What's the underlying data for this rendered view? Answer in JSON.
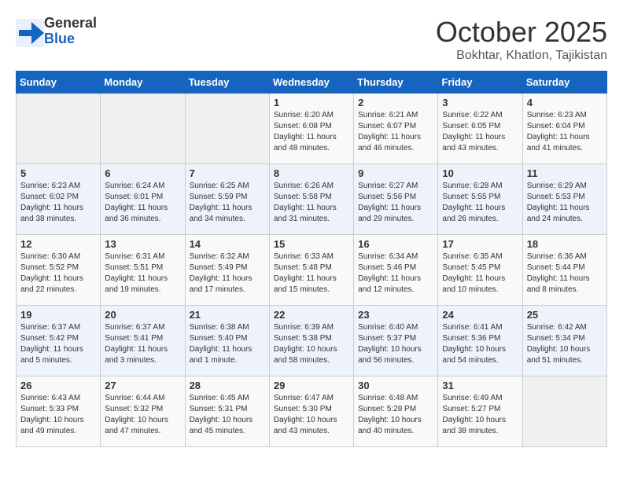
{
  "header": {
    "logo_line1": "General",
    "logo_line2": "Blue",
    "month": "October 2025",
    "location": "Bokhtar, Khatlon, Tajikistan"
  },
  "weekdays": [
    "Sunday",
    "Monday",
    "Tuesday",
    "Wednesday",
    "Thursday",
    "Friday",
    "Saturday"
  ],
  "weeks": [
    [
      {
        "day": "",
        "info": ""
      },
      {
        "day": "",
        "info": ""
      },
      {
        "day": "",
        "info": ""
      },
      {
        "day": "1",
        "info": "Sunrise: 6:20 AM\nSunset: 6:08 PM\nDaylight: 11 hours\nand 48 minutes."
      },
      {
        "day": "2",
        "info": "Sunrise: 6:21 AM\nSunset: 6:07 PM\nDaylight: 11 hours\nand 46 minutes."
      },
      {
        "day": "3",
        "info": "Sunrise: 6:22 AM\nSunset: 6:05 PM\nDaylight: 11 hours\nand 43 minutes."
      },
      {
        "day": "4",
        "info": "Sunrise: 6:23 AM\nSunset: 6:04 PM\nDaylight: 11 hours\nand 41 minutes."
      }
    ],
    [
      {
        "day": "5",
        "info": "Sunrise: 6:23 AM\nSunset: 6:02 PM\nDaylight: 11 hours\nand 38 minutes."
      },
      {
        "day": "6",
        "info": "Sunrise: 6:24 AM\nSunset: 6:01 PM\nDaylight: 11 hours\nand 36 minutes."
      },
      {
        "day": "7",
        "info": "Sunrise: 6:25 AM\nSunset: 5:59 PM\nDaylight: 11 hours\nand 34 minutes."
      },
      {
        "day": "8",
        "info": "Sunrise: 6:26 AM\nSunset: 5:58 PM\nDaylight: 11 hours\nand 31 minutes."
      },
      {
        "day": "9",
        "info": "Sunrise: 6:27 AM\nSunset: 5:56 PM\nDaylight: 11 hours\nand 29 minutes."
      },
      {
        "day": "10",
        "info": "Sunrise: 6:28 AM\nSunset: 5:55 PM\nDaylight: 11 hours\nand 26 minutes."
      },
      {
        "day": "11",
        "info": "Sunrise: 6:29 AM\nSunset: 5:53 PM\nDaylight: 11 hours\nand 24 minutes."
      }
    ],
    [
      {
        "day": "12",
        "info": "Sunrise: 6:30 AM\nSunset: 5:52 PM\nDaylight: 11 hours\nand 22 minutes."
      },
      {
        "day": "13",
        "info": "Sunrise: 6:31 AM\nSunset: 5:51 PM\nDaylight: 11 hours\nand 19 minutes."
      },
      {
        "day": "14",
        "info": "Sunrise: 6:32 AM\nSunset: 5:49 PM\nDaylight: 11 hours\nand 17 minutes."
      },
      {
        "day": "15",
        "info": "Sunrise: 6:33 AM\nSunset: 5:48 PM\nDaylight: 11 hours\nand 15 minutes."
      },
      {
        "day": "16",
        "info": "Sunrise: 6:34 AM\nSunset: 5:46 PM\nDaylight: 11 hours\nand 12 minutes."
      },
      {
        "day": "17",
        "info": "Sunrise: 6:35 AM\nSunset: 5:45 PM\nDaylight: 11 hours\nand 10 minutes."
      },
      {
        "day": "18",
        "info": "Sunrise: 6:36 AM\nSunset: 5:44 PM\nDaylight: 11 hours\nand 8 minutes."
      }
    ],
    [
      {
        "day": "19",
        "info": "Sunrise: 6:37 AM\nSunset: 5:42 PM\nDaylight: 11 hours\nand 5 minutes."
      },
      {
        "day": "20",
        "info": "Sunrise: 6:37 AM\nSunset: 5:41 PM\nDaylight: 11 hours\nand 3 minutes."
      },
      {
        "day": "21",
        "info": "Sunrise: 6:38 AM\nSunset: 5:40 PM\nDaylight: 11 hours\nand 1 minute."
      },
      {
        "day": "22",
        "info": "Sunrise: 6:39 AM\nSunset: 5:38 PM\nDaylight: 10 hours\nand 58 minutes."
      },
      {
        "day": "23",
        "info": "Sunrise: 6:40 AM\nSunset: 5:37 PM\nDaylight: 10 hours\nand 56 minutes."
      },
      {
        "day": "24",
        "info": "Sunrise: 6:41 AM\nSunset: 5:36 PM\nDaylight: 10 hours\nand 54 minutes."
      },
      {
        "day": "25",
        "info": "Sunrise: 6:42 AM\nSunset: 5:34 PM\nDaylight: 10 hours\nand 51 minutes."
      }
    ],
    [
      {
        "day": "26",
        "info": "Sunrise: 6:43 AM\nSunset: 5:33 PM\nDaylight: 10 hours\nand 49 minutes."
      },
      {
        "day": "27",
        "info": "Sunrise: 6:44 AM\nSunset: 5:32 PM\nDaylight: 10 hours\nand 47 minutes."
      },
      {
        "day": "28",
        "info": "Sunrise: 6:45 AM\nSunset: 5:31 PM\nDaylight: 10 hours\nand 45 minutes."
      },
      {
        "day": "29",
        "info": "Sunrise: 6:47 AM\nSunset: 5:30 PM\nDaylight: 10 hours\nand 43 minutes."
      },
      {
        "day": "30",
        "info": "Sunrise: 6:48 AM\nSunset: 5:28 PM\nDaylight: 10 hours\nand 40 minutes."
      },
      {
        "day": "31",
        "info": "Sunrise: 6:49 AM\nSunset: 5:27 PM\nDaylight: 10 hours\nand 38 minutes."
      },
      {
        "day": "",
        "info": ""
      }
    ]
  ]
}
